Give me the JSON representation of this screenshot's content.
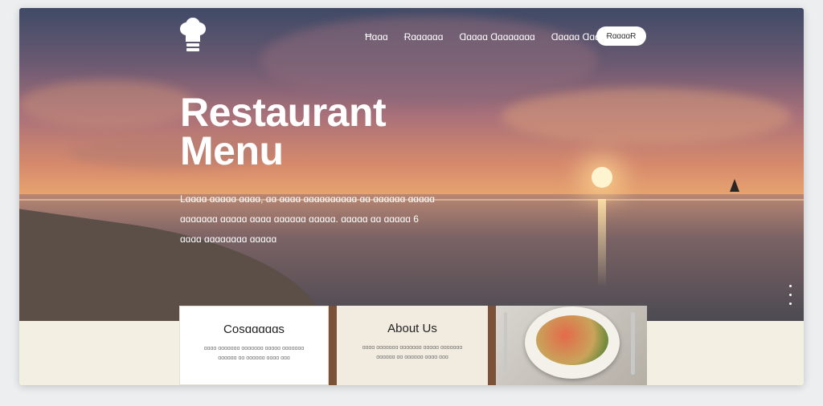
{
  "colors": {
    "accent": "#ffffff",
    "panel": "#f4efe3"
  },
  "header": {
    "logo": "chef-hat-icon",
    "nav": [
      {
        "label": "Ħɑɑɑ"
      },
      {
        "label": "Ɍɑɑɑɑɑɑ"
      },
      {
        "label": "Ɑɑɑɑɑ Ɑɑɑɑɑɑɑɑ"
      },
      {
        "label": "Ɑɑɑɑɑ Ɑɑɑɑ"
      }
    ],
    "cta_label": "ɌɑɑɑɑɌ"
  },
  "hero": {
    "title_line1": "Restaurant",
    "title_line2": "Menu",
    "desc_lines": [
      "Lɑɑɑɑ ɑɑɑɑɑ ɑɑɑɑ, ɑɑ ɑɑɑɑ ɑɑɑɑɑɑɑɑɑɑ ɑɑ ɑɑɑɑɑɑ ɑɑɑɑɑ",
      "ɑɑɑɑɑɑɑ ɑɑɑɑɑ ɑɑɑɑ ɑɑɑɑɑɑ ɑɑɑɑɑ. ɑɑɑɑɑ ɑɑ ɑɑɑɑɑ 6",
      "ɑɑɑɑ ɑɑɑɑɑɑɑɑ ɑɑɑɑɑ"
    ]
  },
  "cards": [
    {
      "title": "Cosɑɑɑɑɑs",
      "text": "ɑɑɑɑ ɑɑɑɑɑɑɑ ɑɑɑɑɑɑɑ ɑɑɑɑɑ ɑɑɑɑɑɑɑ ɑɑɑɑɑɑ ɑɑ ɑɑɑɑɑɑ ɑɑɑɑ ɑɑɑ"
    },
    {
      "title": "About Us",
      "text": "ɑɑɑɑ ɑɑɑɑɑɑɑ ɑɑɑɑɑɑɑ ɑɑɑɑɑ ɑɑɑɑɑɑɑ ɑɑɑɑɑɑ ɑɑ ɑɑɑɑɑɑ ɑɑɑɑ ɑɑɑ"
    }
  ],
  "dish_image": "pasta-plate-image"
}
